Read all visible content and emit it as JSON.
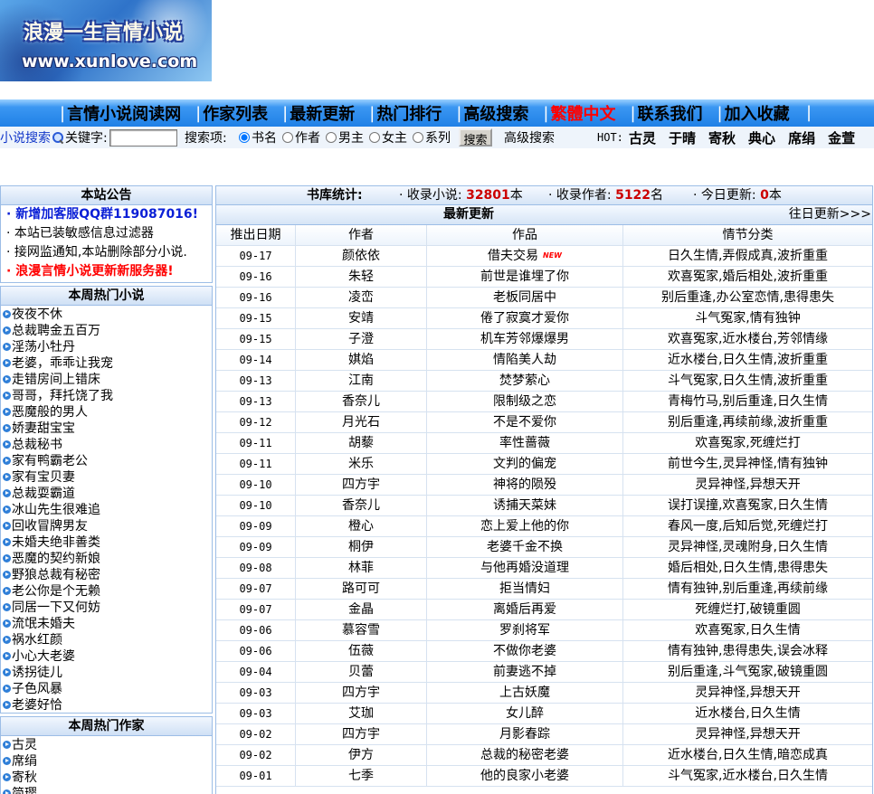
{
  "logo": {
    "title": "浪漫一生言情小说",
    "url": "www.xunlove.com"
  },
  "nav": {
    "separator": "|",
    "items": [
      {
        "label": "言情小说阅读网"
      },
      {
        "label": "作家列表"
      },
      {
        "label": "最新更新"
      },
      {
        "label": "热门排行"
      },
      {
        "label": "高级搜索"
      },
      {
        "label": "繁體中文",
        "color": "#ff0000"
      },
      {
        "label": "联系我们"
      },
      {
        "label": "加入收藏"
      }
    ]
  },
  "search": {
    "label": "小说搜索",
    "keyword_label": "关键字:",
    "keyword_value": "",
    "scope_label": "搜索项:",
    "options": [
      {
        "label": "书名",
        "checked": true
      },
      {
        "label": "作者",
        "checked": false
      },
      {
        "label": "男主",
        "checked": false
      },
      {
        "label": "女主",
        "checked": false
      },
      {
        "label": "系列",
        "checked": false
      }
    ],
    "button_label": "搜索",
    "advanced_label": "高级搜索",
    "hot_label": "HOT:",
    "hot_authors": [
      "古灵",
      "于晴",
      "寄秋",
      "典心",
      "席绢",
      "金萱"
    ]
  },
  "notice": {
    "title": "本站公告",
    "items": [
      {
        "text": "· 新增加客服QQ群119087016!",
        "color": "#0a1fd6",
        "weight": "bold"
      },
      {
        "text": "· 本站已装敏感信息过滤器"
      },
      {
        "text": "· 接网监通知,本站删除部分小说."
      },
      {
        "text": "· 浪漫言情小说更新新服务器!",
        "color": "#ff0000",
        "weight": "bold"
      }
    ]
  },
  "hot_novels": {
    "title": "本周热门小说",
    "items": [
      "夜夜不休",
      "总裁聘金五百万",
      "淫荡小牡丹",
      "老婆，乖乖让我宠",
      "走错房间上错床",
      "哥哥，拜托饶了我",
      "恶魔般的男人",
      "娇妻甜宝宝",
      "总裁秘书",
      "家有鸭霸老公",
      "家有宝贝妻",
      "总裁耍霸道",
      "冰山先生很难追",
      "回收冒牌男友",
      "未婚夫绝非善类",
      "恶魔的契约新娘",
      "野狼总裁有秘密",
      "老公你是个无赖",
      "同居一下又何妨",
      "流氓未婚夫",
      "祸水红颜",
      "小心大老婆",
      "诱拐徒儿",
      "子色风暴",
      "老婆好恰"
    ]
  },
  "hot_authors": {
    "title": "本周热门作家",
    "items": [
      "古灵",
      "席绢",
      "寄秋",
      "简璎"
    ]
  },
  "stats": {
    "title": "书库统计:",
    "value_color": "#cc0000",
    "items": [
      {
        "label": "· 收录小说:",
        "value": "32801",
        "unit": "本"
      },
      {
        "label": "· 收录作者:",
        "value": "5122",
        "unit": "名"
      },
      {
        "label": "· 今日更新:",
        "value": "0",
        "unit": "本"
      }
    ]
  },
  "latest": {
    "title": "最新更新",
    "more": "往日更新>>>",
    "columns": [
      "推出日期",
      "作者",
      "作品",
      "情节分类"
    ],
    "rows": [
      {
        "date": "09-17",
        "author": "颜依依",
        "title": "借夫交易",
        "badge": "NEW",
        "category": "日久生情,弄假成真,波折重重"
      },
      {
        "date": "09-16",
        "author": "朱轻",
        "title": "前世是谁埋了你",
        "category": "欢喜冤家,婚后相处,波折重重"
      },
      {
        "date": "09-16",
        "author": "凌峦",
        "title": "老板同居中",
        "category": "别后重逢,办公室恋情,患得患失"
      },
      {
        "date": "09-15",
        "author": "安靖",
        "title": "倦了寂寞才爱你",
        "category": "斗气冤家,情有独钟"
      },
      {
        "date": "09-15",
        "author": "子澄",
        "title": "机车芳邻爆爆男",
        "category": "欢喜冤家,近水楼台,芳邻情缘"
      },
      {
        "date": "09-14",
        "author": "娸焰",
        "title": "情陷美人劫",
        "category": "近水楼台,日久生情,波折重重"
      },
      {
        "date": "09-13",
        "author": "江南",
        "title": "焚梦萦心",
        "category": "斗气冤家,日久生情,波折重重"
      },
      {
        "date": "09-13",
        "author": "香奈儿",
        "title": "限制级之恋",
        "category": "青梅竹马,别后重逢,日久生情"
      },
      {
        "date": "09-12",
        "author": "月光石",
        "title": "不是不爱你",
        "category": "别后重逢,再续前缘,波折重重"
      },
      {
        "date": "09-11",
        "author": "胡藜",
        "title": "率性蔷薇",
        "category": "欢喜冤家,死缠烂打"
      },
      {
        "date": "09-11",
        "author": "米乐",
        "title": "文判的偏宠",
        "category": "前世今生,灵异神怪,情有独钟"
      },
      {
        "date": "09-10",
        "author": "四方宇",
        "title": "神将的陨殁",
        "category": "灵异神怪,异想天开"
      },
      {
        "date": "09-10",
        "author": "香奈儿",
        "title": "诱捕天菜妹",
        "category": "误打误撞,欢喜冤家,日久生情"
      },
      {
        "date": "09-09",
        "author": "橙心",
        "title": "恋上爱上他的你",
        "category": "春风一度,后知后觉,死缠烂打"
      },
      {
        "date": "09-09",
        "author": "桐伊",
        "title": "老婆千金不换",
        "category": "灵异神怪,灵魂附身,日久生情"
      },
      {
        "date": "09-08",
        "author": "林菲",
        "title": "与他再婚没道理",
        "category": "婚后相处,日久生情,患得患失"
      },
      {
        "date": "09-07",
        "author": "路可可",
        "title": "拒当情妇",
        "category": "情有独钟,别后重逢,再续前缘"
      },
      {
        "date": "09-07",
        "author": "金晶",
        "title": "离婚后再爱",
        "category": "死缠烂打,破镜重圆"
      },
      {
        "date": "09-06",
        "author": "慕容雪",
        "title": "罗刹将军",
        "category": "欢喜冤家,日久生情"
      },
      {
        "date": "09-06",
        "author": "伍薇",
        "title": "不做你老婆",
        "category": "情有独钟,患得患失,误会冰释"
      },
      {
        "date": "09-04",
        "author": "贝蕾",
        "title": "前妻逃不掉",
        "category": "别后重逢,斗气冤家,破镜重圆"
      },
      {
        "date": "09-03",
        "author": "四方宇",
        "title": "上古妖魔",
        "category": "灵异神怪,异想天开"
      },
      {
        "date": "09-03",
        "author": "艾珈",
        "title": "女儿醉",
        "category": "近水楼台,日久生情"
      },
      {
        "date": "09-02",
        "author": "四方宇",
        "title": "月影春踪",
        "category": "灵异神怪,异想天开"
      },
      {
        "date": "09-02",
        "author": "伊方",
        "title": "总裁的秘密老婆",
        "category": "近水楼台,日久生情,暗恋成真"
      },
      {
        "date": "09-01",
        "author": "七季",
        "title": "他的良家小老婆",
        "category": "斗气冤家,近水楼台,日久生情"
      }
    ]
  },
  "icons": {
    "list_bullet": "arrow-circle-icon",
    "search": "magnifier-icon"
  },
  "colors": {
    "nav_bar": "#1f80e6",
    "link_blue": "#1237c9",
    "border": "#9cbde6",
    "highlight_red": "#ff0000"
  }
}
